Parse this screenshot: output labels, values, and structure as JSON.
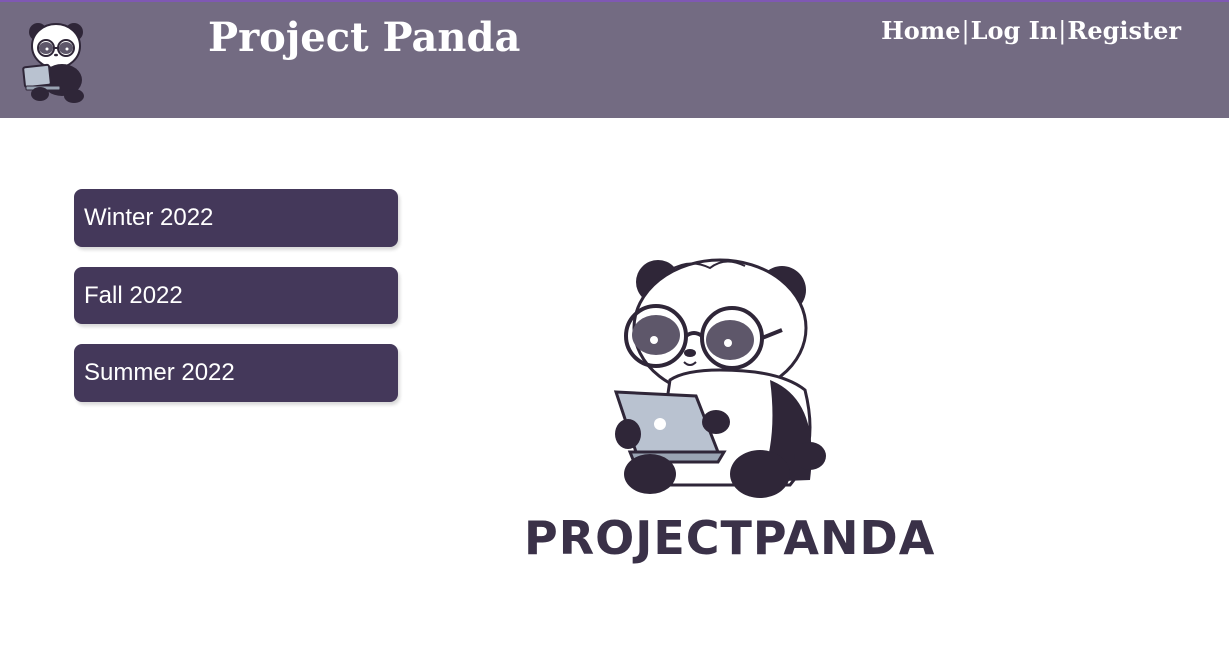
{
  "header": {
    "title": "Project Panda",
    "logo_icon": "panda-mascot-icon",
    "background_color": "#736b82",
    "accent_color": "#7f58b3"
  },
  "nav": {
    "home": "Home",
    "login": "Log In",
    "register": "Register",
    "separator": "|"
  },
  "terms": [
    {
      "label": "Winter 2022"
    },
    {
      "label": "Fall 2022"
    },
    {
      "label": "Summer 2022"
    }
  ],
  "term_button_color": "#44385a",
  "hero": {
    "icon": "panda-with-laptop-icon",
    "wordmark": "PROJECTPANDA",
    "wordmark_color": "#3a3148"
  }
}
